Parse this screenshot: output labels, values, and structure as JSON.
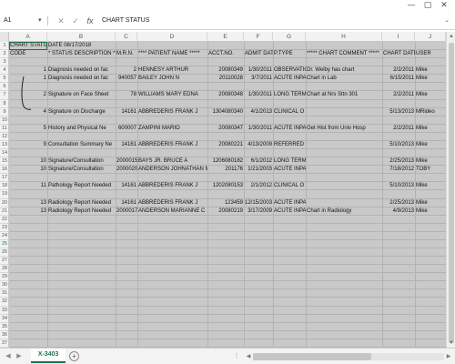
{
  "window": {
    "minimize": "—",
    "restore": "▢",
    "close": "✕"
  },
  "formula_bar": {
    "name_box": "A1",
    "name_box_caret": "▾",
    "cancel_glyph": "✕",
    "enter_glyph": "✓",
    "fx_glyph": "fx",
    "content": "CHART STATUS",
    "expand_glyph": "⌄"
  },
  "columns": [
    "A",
    "B",
    "C",
    "D",
    "E",
    "F",
    "G",
    "H",
    "I",
    "J"
  ],
  "row_numbers": [
    "1",
    "2",
    "3",
    "4",
    "5",
    "6",
    "7",
    "8",
    "9",
    "10",
    "11",
    "12",
    "13",
    "14",
    "15",
    "16",
    "17",
    "18",
    "19",
    "20",
    "21",
    "22",
    "23",
    "24",
    "25",
    "26",
    "27",
    "28",
    "29",
    "30",
    "31",
    "32",
    "33",
    "34",
    "35",
    "36",
    "37"
  ],
  "selected_row": "25",
  "rows": [
    {
      "a": "CHART STATUS",
      "b": "DATE 08/17/2018"
    },
    {
      "a": "CODE",
      "b": "* STATUS DESCRIPTION **",
      "c": "M.R.N.",
      "d": "**** PATIENT NAME *****",
      "e": "ACCT.NO.",
      "f": "ADMIT DATE",
      "g": "P.TYPE",
      "h": "***** CHART COMMENT *****",
      "i": "CHART DATE",
      "j": "USER"
    },
    {},
    {
      "a": "1",
      "b": "Diagnosis needed on fac",
      "c": "2",
      "d": "HENNESY ARTHUR",
      "e": "20080349",
      "f": "1/30/2011",
      "g": "OBSERVATIO",
      "h": "Dr. Welby has chart",
      "i": "2/2/2011",
      "j": "Mike"
    },
    {
      "a": "1",
      "b": "Diagnosis needed on fac",
      "c": "940057",
      "d": "BAILEY JOHN N",
      "e": "20110028",
      "f": "3/7/2011",
      "g": "ACUTE INPA",
      "h": "Chart in Lab",
      "i": "6/15/2011",
      "j": "Mike"
    },
    {},
    {
      "a": "2",
      "b": "Signature on Face Sheet",
      "c": "78",
      "d": "WILLIAMS MARY EDNA",
      "e": "20080348",
      "f": "1/30/2011",
      "g": "LONG TERM",
      "h": "Chart at Nrs Sttn 301",
      "i": "2/2/2011",
      "j": "Mike"
    },
    {},
    {
      "a": "4",
      "b": "Signature on Discharge",
      "c": "14161",
      "d": "ABBREDERIS FRANK J",
      "e": "1304080340",
      "f": "4/1/2013",
      "g": "CLINICAL O",
      "h": "",
      "i": "5/13/2013",
      "j": "MRideo"
    },
    {},
    {
      "a": "5",
      "b": "History and Physical Ne",
      "c": "600007",
      "d": "ZAMPINI MARIO",
      "e": "20080347",
      "f": "1/30/2011",
      "g": "ACUTE INPA",
      "h": "Get Hist from Univ Hosp",
      "i": "2/2/2011",
      "j": "Mike"
    },
    {},
    {
      "a": "9",
      "b": "Consultation Summary Ne",
      "c": "14161",
      "d": "ABBREDERIS FRANK J",
      "e": "20080221",
      "f": "4/13/2009",
      "g": "REFERRED O",
      "h": "",
      "i": "5/10/2013",
      "j": "Mike"
    },
    {},
    {
      "a": "10",
      "b": "Signature/Consultation",
      "c": "2000015",
      "d": "BAYS JR. BRUCE A",
      "e": "1206080182",
      "f": "6/1/2012",
      "g": "LONG TERM",
      "h": "",
      "i": "2/25/2013",
      "j": "Mike"
    },
    {
      "a": "10",
      "b": "Signature/Consultation",
      "c": "2000020",
      "d": "ANDERSON JOHNATHAN M",
      "e": "201176",
      "f": "1/21/2003",
      "g": "ACUTE INPA",
      "h": "",
      "i": "7/18/2012",
      "j": "TOBY"
    },
    {},
    {
      "a": "11",
      "b": "Pathology Report Needed",
      "c": "14161",
      "d": "ABBREDERIS FRANK J",
      "e": "1202080153",
      "f": "2/1/2012",
      "g": "CLINICAL O",
      "h": "",
      "i": "5/10/2013",
      "j": "Mike"
    },
    {},
    {
      "a": "13",
      "b": "Radiology Report Needed",
      "c": "14161",
      "d": "ABBREDERIS FRANK J",
      "e": "123459",
      "f": "12/15/2003",
      "g": "ACUTE INPA",
      "h": "",
      "i": "2/25/2013",
      "j": "Mike"
    },
    {
      "a": "13",
      "b": "Radiology Report Needed",
      "c": "2000017",
      "d": "ANDERSON MARIANNE C",
      "e": "20080219",
      "f": "3/17/2009",
      "g": "ACUTE INPA",
      "h": "Chart in Radiology",
      "i": "4/9/2013",
      "j": "Mike"
    }
  ],
  "sheet_tab": "X-3403",
  "add_sheet_glyph": "+",
  "nav_prev": "◀",
  "nav_next": "▶",
  "more_glyph": "⋮",
  "colors": {
    "accent": "#217346",
    "grid_bg": "#c9c9c9"
  }
}
